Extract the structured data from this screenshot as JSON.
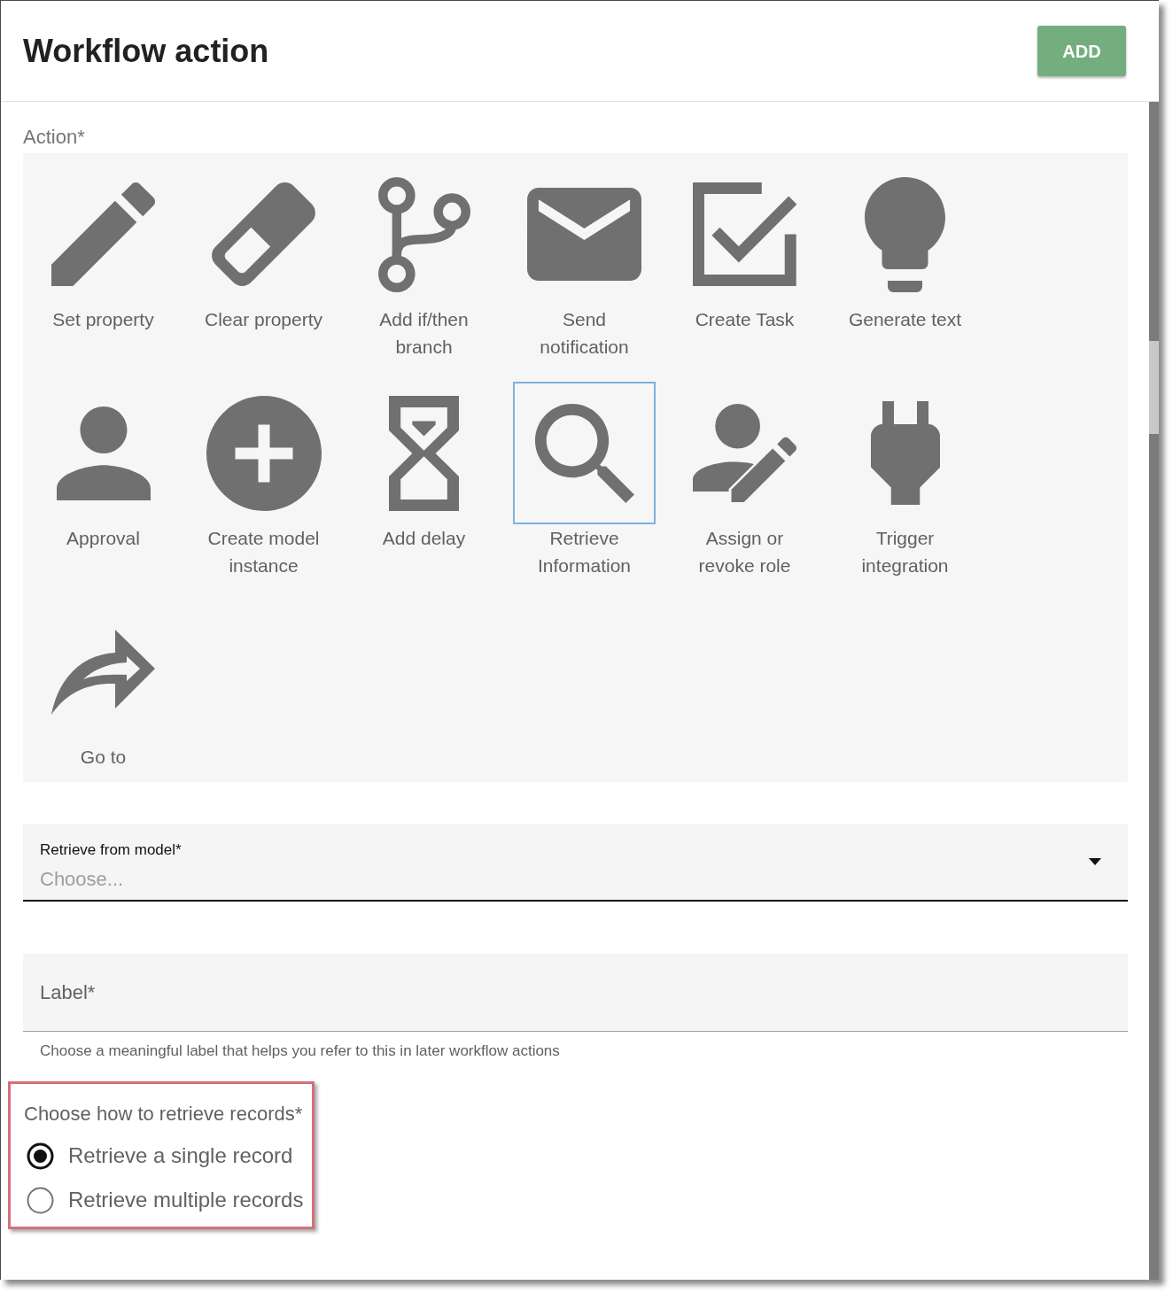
{
  "dialog": {
    "title": "Workflow action",
    "add_button": "ADD"
  },
  "action": {
    "label": "Action*",
    "options": [
      {
        "label": "Set property",
        "selected": false
      },
      {
        "label": "Clear property",
        "selected": false
      },
      {
        "label": "Add if/then branch",
        "selected": false
      },
      {
        "label": "Send notification",
        "selected": false
      },
      {
        "label": "Create Task",
        "selected": false
      },
      {
        "label": "Generate text",
        "selected": false
      },
      {
        "label": "Approval",
        "selected": false
      },
      {
        "label": "Create model instance",
        "selected": false
      },
      {
        "label": "Add delay",
        "selected": false
      },
      {
        "label": "Retrieve Information",
        "selected": true
      },
      {
        "label": "Assign or revoke role",
        "selected": false
      },
      {
        "label": "Trigger integration",
        "selected": false
      },
      {
        "label": "Go to",
        "selected": false
      }
    ]
  },
  "model_select": {
    "label": "Retrieve from model*",
    "placeholder": "Choose..."
  },
  "label_field": {
    "placeholder": "Label*",
    "helper_text": "Choose a meaningful label that helps you refer to this in later workflow actions"
  },
  "retrieve_mode": {
    "label": "Choose how to retrieve records*",
    "highlighted": true,
    "options": [
      {
        "label": "Retrieve a single record",
        "selected": true
      },
      {
        "label": "Retrieve multiple records",
        "selected": false
      }
    ]
  }
}
